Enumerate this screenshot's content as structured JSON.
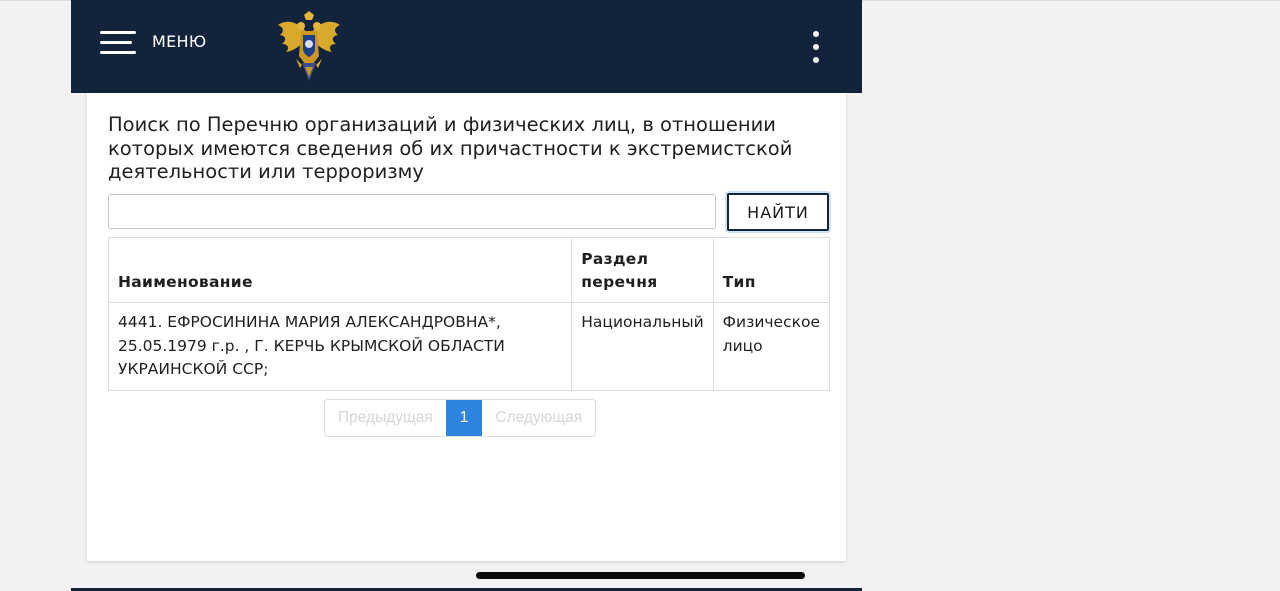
{
  "header": {
    "menu_label": "МЕНЮ",
    "icons": {
      "menu": "hamburger-icon",
      "emblem": "double-headed-eagle-emblem",
      "more": "kebab-vertical-icon"
    },
    "colors": {
      "background": "#13233c",
      "foreground": "#ffffff"
    }
  },
  "search": {
    "title": "Поиск по Перечню организаций и физических лиц, в отношении которых имеются сведения об их причастности к экстремистской деятельности или терроризму",
    "input_value": "",
    "button_label": "НАЙТИ"
  },
  "table": {
    "columns": [
      "Наименование",
      "Раздел перечня",
      "Тип"
    ],
    "rows": [
      {
        "name": "4441. ЕФРОСИНИНА МАРИЯ АЛЕКСАНДРОВНА*, 25.05.1979 г.р. , Г. КЕРЧЬ КРЫМСКОЙ ОБЛАСТИ УКРАИНСКОЙ ССР;",
        "section": "Национальный",
        "type": "Физическое лицо"
      }
    ]
  },
  "pagination": {
    "prev_label": "Предыдущая",
    "current_page": "1",
    "next_label": "Следующая",
    "active_color": "#2f84e0"
  }
}
